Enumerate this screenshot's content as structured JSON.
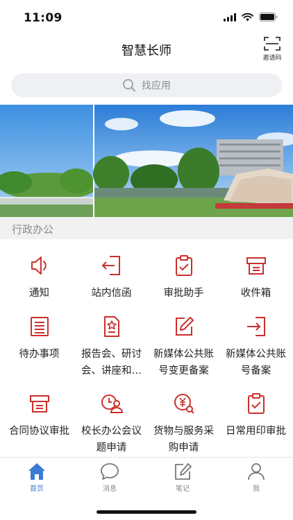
{
  "status_bar": {
    "time": "11:09"
  },
  "header": {
    "title": "智慧长师",
    "invite_label": "邀请码"
  },
  "search": {
    "placeholder": "找应用"
  },
  "section": {
    "title": "行政办公"
  },
  "grid": [
    {
      "label": "通知",
      "icon": "speaker-icon"
    },
    {
      "label": "站内信函",
      "icon": "inbox-arrow-icon"
    },
    {
      "label": "审批助手",
      "icon": "clipboard-check-icon"
    },
    {
      "label": "收件箱",
      "icon": "printer-tray-icon"
    },
    {
      "label": "待办事项",
      "icon": "list-icon"
    },
    {
      "label": "报告会、研讨\n会、讲座和…",
      "icon": "document-star-icon"
    },
    {
      "label": "新媒体公共账\n号变更备案",
      "icon": "edit-icon"
    },
    {
      "label": "新媒体公共账\n号备案",
      "icon": "sign-in-icon"
    },
    {
      "label": "合同协议审批",
      "icon": "printer-icon"
    },
    {
      "label": "校长办公会议\n题申请",
      "icon": "user-clock-icon"
    },
    {
      "label": "货物与服务采\n购申请",
      "icon": "yen-search-icon"
    },
    {
      "label": "日常用印审批",
      "icon": "clipboard-check-icon"
    }
  ],
  "tabs": [
    {
      "label": "首页",
      "icon": "home-icon",
      "active": true
    },
    {
      "label": "消息",
      "icon": "chat-icon",
      "active": false
    },
    {
      "label": "笔记",
      "icon": "note-icon",
      "active": false
    },
    {
      "label": "我",
      "icon": "user-icon",
      "active": false
    }
  ],
  "colors": {
    "accent_red": "#c9302c",
    "tab_active": "#3a7bd5",
    "tab_inactive": "#888888"
  }
}
